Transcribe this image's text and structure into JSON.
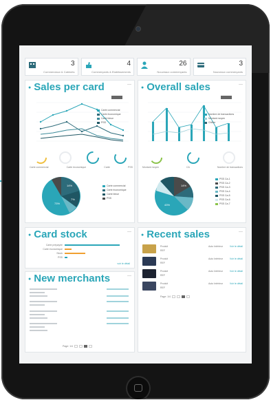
{
  "stats": [
    {
      "value": "3",
      "label": "Commerciaux & Cabinets",
      "icon": "office-icon"
    },
    {
      "value": "4",
      "label": "Commerçants & Etablissements",
      "icon": "hand-icon"
    },
    {
      "value": "26",
      "label": "Nouveaux commerçants",
      "icon": "user-icon"
    },
    {
      "value": "3",
      "label": "Nouveaux commerçants",
      "icon": "card-icon"
    }
  ],
  "sales_per_card": {
    "title": "Sales per card",
    "legend": [
      "Carte commercial",
      "Carte économique",
      "Carte bleue",
      "PSS"
    ],
    "gauges": [
      "Carte commercial",
      "Carte économique",
      "Carte",
      "PSS"
    ],
    "pie_legend": [
      "Carte commercial",
      "Carte économique",
      "Carte bleue",
      "PSS"
    ],
    "pie_labels": [
      "73%",
      "14%",
      "7%"
    ]
  },
  "overall_sales": {
    "title": "Overall sales",
    "legend": [
      "Nombre de transactions",
      "Montant moyen",
      "Chiffre"
    ],
    "gauges": [
      "Montant moyen",
      "CA",
      "Nombre de transactions"
    ],
    "pie_legend": [
      "PSS Ca-1",
      "PSS Ca-2",
      "PSS Ca-3",
      "PSS Ca-4",
      "PSS Ca-5",
      "PSS Ca-6",
      "PSS Ca-7"
    ],
    "pie_labels": [
      "43%",
      "14%"
    ]
  },
  "card_stock": {
    "title": "Card stock",
    "rows": [
      "Carte prépayée",
      "Carte économique",
      "Stock",
      "PSS"
    ],
    "footer": "voir le détail"
  },
  "recent_sales": {
    "title": "Recent sales",
    "items": [
      {
        "product": "Produit",
        "ref": "REF",
        "amount": "Auto Intérieur",
        "link": "Voir le détail"
      },
      {
        "product": "Produit",
        "ref": "REF",
        "amount": "Auto Intérieur",
        "link": "Voir le détail"
      },
      {
        "product": "Produit",
        "ref": "REF",
        "amount": "Auto Intérieur",
        "link": "Voir le détail"
      },
      {
        "product": "Produit",
        "ref": "REF",
        "amount": "Auto Intérieur",
        "link": "Voir le détail"
      }
    ],
    "pager": "Page: 1/4"
  },
  "new_merchants": {
    "title": "New merchants",
    "pager": "Page: 1/4"
  },
  "colors": {
    "accent": "#2aa6b8",
    "dark_series": "#2d6b7a",
    "orange": "#f0a030",
    "green": "#8bc34a"
  }
}
